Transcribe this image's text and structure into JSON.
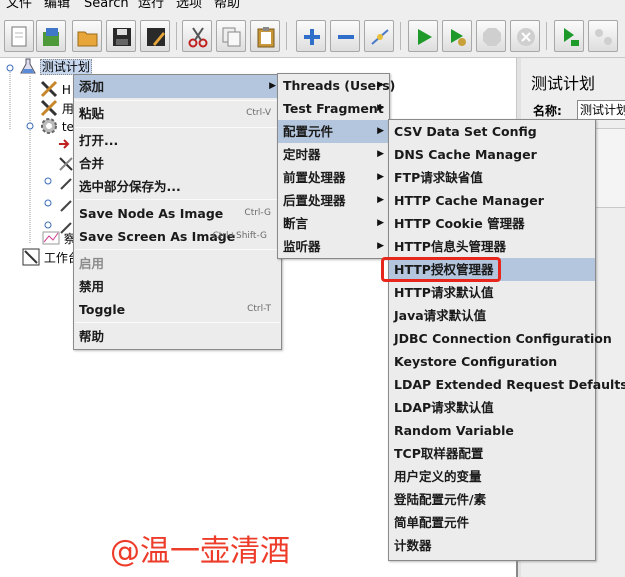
{
  "menubar": {
    "items": [
      {
        "label": "文件"
      },
      {
        "label": "编辑"
      },
      {
        "label": "Search"
      },
      {
        "label": "运行"
      },
      {
        "label": "选项"
      },
      {
        "label": "帮助"
      }
    ]
  },
  "tree": {
    "root_label": "测试计划",
    "item_h": "H",
    "item_yong": "用",
    "item_te": "te",
    "item_cha": "察",
    "item_workbench": "工作台"
  },
  "panel": {
    "title": "测试计划",
    "name_label": "名称:",
    "name_value": "测试计划"
  },
  "context_menu": {
    "items": [
      {
        "label": "添加",
        "submenu": true,
        "selected": true
      },
      {
        "label": "粘贴",
        "accel": "Ctrl-V"
      },
      {
        "label": "打开..."
      },
      {
        "label": "合并"
      },
      {
        "label": "选中部分保存为..."
      },
      {
        "label": "Save Node As Image",
        "accel": "Ctrl-G"
      },
      {
        "label": "Save Screen As Image",
        "accel": "Ctrl+Shift-G"
      },
      {
        "label": "启用",
        "disabled": true
      },
      {
        "label": "禁用"
      },
      {
        "label": "Toggle",
        "accel": "Ctrl-T"
      },
      {
        "label": "帮助"
      }
    ]
  },
  "add_submenu": {
    "items": [
      {
        "label": "Threads (Users)"
      },
      {
        "label": "Test Fragment"
      },
      {
        "label": "配置元件",
        "selected": true
      },
      {
        "label": "定时器"
      },
      {
        "label": "前置处理器"
      },
      {
        "label": "后置处理器"
      },
      {
        "label": "断言"
      },
      {
        "label": "监听器"
      }
    ]
  },
  "config_submenu": {
    "items": [
      {
        "label": "CSV Data Set Config"
      },
      {
        "label": "DNS Cache Manager"
      },
      {
        "label": "FTP请求缺省值"
      },
      {
        "label": "HTTP Cache Manager"
      },
      {
        "label": "HTTP Cookie 管理器"
      },
      {
        "label": "HTTP信息头管理器"
      },
      {
        "label": "HTTP授权管理器",
        "selected": true
      },
      {
        "label": "HTTP请求默认值"
      },
      {
        "label": "Java请求默认值"
      },
      {
        "label": "JDBC Connection Configuration"
      },
      {
        "label": "Keystore Configuration"
      },
      {
        "label": "LDAP Extended Request Defaults"
      },
      {
        "label": "LDAP请求默认值"
      },
      {
        "label": "Random Variable"
      },
      {
        "label": "TCP取样器配置"
      },
      {
        "label": "用户定义的变量"
      },
      {
        "label": "登陆配置元件/素"
      },
      {
        "label": "简单配置元件"
      },
      {
        "label": "计数器"
      }
    ]
  },
  "watermark": "@温一壶清酒",
  "colors": {
    "menu_bg": "#ececec",
    "selected_bg": "#b4c6dd",
    "highlight": "#e8271c",
    "watermark": "#ee3c2a"
  }
}
